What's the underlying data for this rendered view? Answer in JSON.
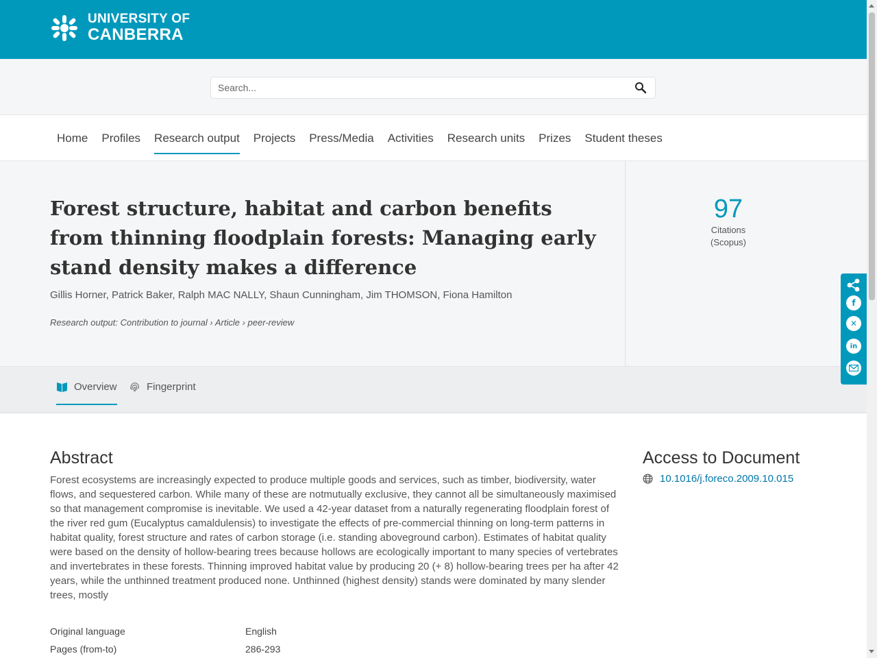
{
  "header": {
    "logo_line1": "UNIVERSITY OF",
    "logo_line2": "CANBERRA",
    "brand_color": "#0099bc"
  },
  "search": {
    "placeholder": "Search...",
    "icon": "search-icon"
  },
  "nav": {
    "items": [
      {
        "label": "Home"
      },
      {
        "label": "Profiles"
      },
      {
        "label": "Research output",
        "active": true
      },
      {
        "label": "Projects"
      },
      {
        "label": "Press/Media"
      },
      {
        "label": "Activities"
      },
      {
        "label": "Research units"
      },
      {
        "label": "Prizes"
      },
      {
        "label": "Student theses"
      }
    ]
  },
  "publication": {
    "title": "Forest structure, habitat and carbon benefits from thinning floodplain forests: Managing early stand density makes a difference",
    "authors": "Gillis Horner, Patrick Baker, Ralph MAC NALLY, Shaun Cunningham, Jim THOMSON, Fiona Hamilton",
    "type": "Research output: Contribution to journal › Article › peer-review"
  },
  "metric": {
    "value": "97",
    "label_line1": "Citations",
    "label_line2": "(Scopus)"
  },
  "tabs": [
    {
      "label": "Overview",
      "icon": "book-icon",
      "active": true
    },
    {
      "label": "Fingerprint",
      "icon": "fingerprint-icon"
    }
  ],
  "share": {
    "icons": [
      "share-icon",
      "facebook-icon",
      "x-icon",
      "linkedin-icon",
      "email-icon"
    ]
  },
  "abstract": {
    "heading": "Abstract",
    "text": "Forest ecosystems are increasingly expected to produce multiple goods and services, such as timber, biodiversity, water flows, and sequestered carbon. While many of these are notmutually exclusive, they cannot all be simultaneously maximised so that management compromise is inevitable. We used a 42-year dataset from a naturally regenerating floodplain forest of the river red gum (Eucalyptus camaldulensis) to investigate the effects of pre-commercial thinning on long-term patterns in habitat quality, forest structure and rates of carbon storage (i.e. standing aboveground carbon). Estimates of habitat quality were based on the density of hollow-bearing trees because hollows are ecologically important to many species of vertebrates and invertebrates in these forests. Thinning improved habitat value by producing 20 (+ 8) hollow-bearing trees per ha after 42 years, while the unthinned treatment produced none. Unthinned (highest density) stands were dominated by many slender trees, mostly"
  },
  "access": {
    "heading": "Access to Document",
    "doi": "10.1016/j.foreco.2009.10.015",
    "icon": "globe-icon"
  },
  "details": [
    {
      "key": "Original language",
      "value": "English"
    },
    {
      "key": "Pages (from-to)",
      "value": "286-293"
    }
  ]
}
